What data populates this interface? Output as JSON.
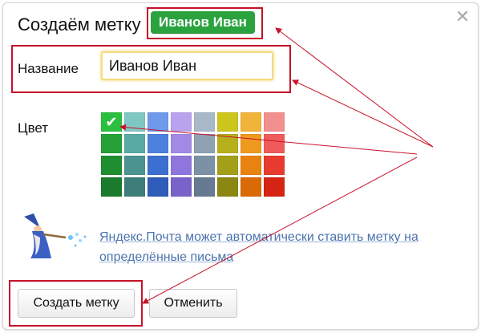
{
  "dialog": {
    "title": "Создаём метку",
    "preview_chip": "Иванов Иван",
    "close_icon": "close-icon",
    "name_label": "Название",
    "name_value": "Иванов Иван",
    "color_label": "Цвет",
    "palette": {
      "selected_index": 0,
      "colors": [
        "#2bbf3f",
        "#7fc7c2",
        "#6f99ea",
        "#b9a3ef",
        "#a8b8c7",
        "#cbc51c",
        "#f0b43a",
        "#f28f8f",
        "#25a037",
        "#5aaaa4",
        "#4d81e0",
        "#a08ae6",
        "#8fa2b4",
        "#b7b01c",
        "#ee9a1f",
        "#ef5b5b",
        "#1f8e31",
        "#4b9390",
        "#3b6fd0",
        "#8f76dc",
        "#7d91a6",
        "#a39f18",
        "#e8830f",
        "#e83b30",
        "#1b7a2c",
        "#3d7e7a",
        "#2f5cb8",
        "#7a63c8",
        "#667b91",
        "#8b8712",
        "#da6a06",
        "#d62414"
      ]
    },
    "promo_text": "Яндекс.Почта может автоматически ставить метку на определённые письма",
    "mascot_icon": "wizard-mascot-icon",
    "create_button": "Создать метку",
    "cancel_button": "Отменить"
  },
  "accent_colors": {
    "chip": "#2aa33f",
    "highlight": "#c6122a",
    "link": "#4b73ad"
  }
}
